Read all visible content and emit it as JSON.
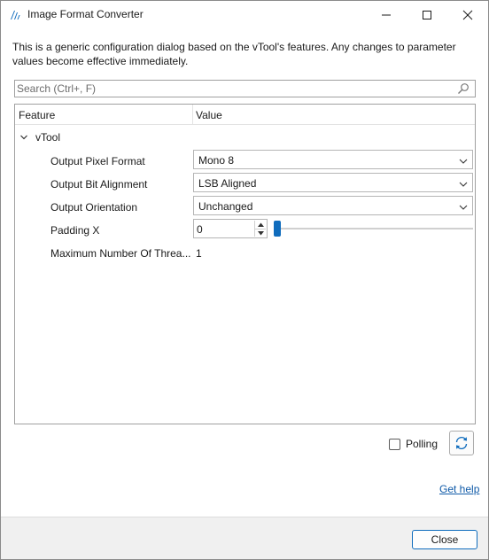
{
  "window": {
    "title": "Image Format Converter",
    "icon": "app-logo-icon"
  },
  "window_controls": {
    "minimize_icon": "minimize-icon",
    "maximize_icon": "maximize-icon",
    "close_icon": "close-icon"
  },
  "description": "This is a generic configuration dialog based on the vTool's features. Any changes to parameter values become effective immediately.",
  "search": {
    "placeholder": "Search (Ctrl+, F)",
    "value": "",
    "icon": "search-icon"
  },
  "grid": {
    "columns": [
      "Feature",
      "Value"
    ],
    "group": {
      "label": "vTool",
      "expanded": true,
      "icon": "chevron-down-icon"
    },
    "rows": [
      {
        "label": "Output Pixel Format",
        "value": "Mono 8",
        "control": "dropdown"
      },
      {
        "label": "Output Bit Alignment",
        "value": "LSB Aligned",
        "control": "dropdown"
      },
      {
        "label": "Output Orientation",
        "value": "Unchanged",
        "control": "dropdown"
      },
      {
        "label": "Padding X",
        "value": "0",
        "control": "spin-slider",
        "slider_fraction": 0.0
      },
      {
        "label": "Maximum Number Of Threa...",
        "value": "1",
        "control": "readonly"
      }
    ]
  },
  "polling": {
    "label": "Polling",
    "checked": false
  },
  "refresh": {
    "icon": "refresh-icon"
  },
  "help": {
    "label": "Get help"
  },
  "footer": {
    "close_label": "Close"
  },
  "colors": {
    "accent": "#0f6cbd",
    "link": "#0f5aa8"
  }
}
